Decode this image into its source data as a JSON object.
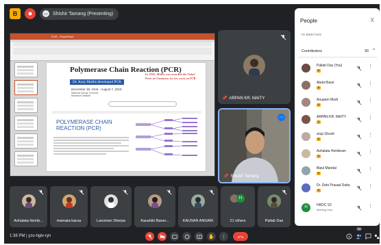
{
  "presenter_pill": "Shishir Tamang (Presenting)",
  "window_buttons": {
    "hand_badge": "B"
  },
  "slide": {
    "app_title": "PCR - PowerPoint",
    "title": "Polymerase Chain Reaction (PCR)",
    "nobel": "In 1993, Mullis was awarded the Nobel Prize in Chemistry for his work on PCR.",
    "subtitle": "Dr. Kary Mullis developed PCR",
    "dates": "December 28, 1944 - August 7, 2019",
    "institute": "National Human Genome Research Institute",
    "heading2": "POLYMERASE CHAIN REACTION (PCR)"
  },
  "tiles": {
    "arpan": "ARPAN KR. MAITY",
    "shishir": "Shishir Tamang"
  },
  "strip": [
    {
      "name": "Ashalata Hemb..."
    },
    {
      "name": "mamata barua"
    },
    {
      "name": "Laxuman Sherpa"
    },
    {
      "name": "Kaushiki Baner..."
    },
    {
      "name": "KAUSAR ANSARI"
    },
    {
      "name": "21 others",
      "initial": "H"
    },
    {
      "name": "Pallab Das"
    }
  ],
  "bottombar": {
    "meeting_info": "1:38 PM  |  yzo-hgtv-ryn",
    "people_count": "30"
  },
  "panel": {
    "title": "People",
    "close": "X",
    "in_meeting": "IN MEETING",
    "contributors_label": "Contributors",
    "contributors_count": "30",
    "people": [
      {
        "name": "Pallab Das (You)",
        "badge": "B"
      },
      {
        "name": "Abdul Basir",
        "badge": "B"
      },
      {
        "name": "Anupam Mudi",
        "badge": "B"
      },
      {
        "name": "ARPAN KR. MAITY",
        "badge": "B"
      },
      {
        "name": "arup Ghosh",
        "badge": "B"
      },
      {
        "name": "Ashalata Hembram",
        "badge": "B"
      },
      {
        "name": "Bipul Mandal",
        "badge": "B"
      },
      {
        "name": "Dr. Debi Prasad Datta",
        "badge": "B"
      },
      {
        "name": "HRDC V2",
        "sub": "Meeting host",
        "initial": "H"
      }
    ]
  },
  "colors": {
    "meet_bg": "#202124",
    "tile_bg": "#3c4043",
    "active_speaker_border": "#8ab4f8",
    "danger": "#ea4335",
    "accent_yellow": "#f9ab00",
    "host_avatar": "#1e8e3e"
  }
}
